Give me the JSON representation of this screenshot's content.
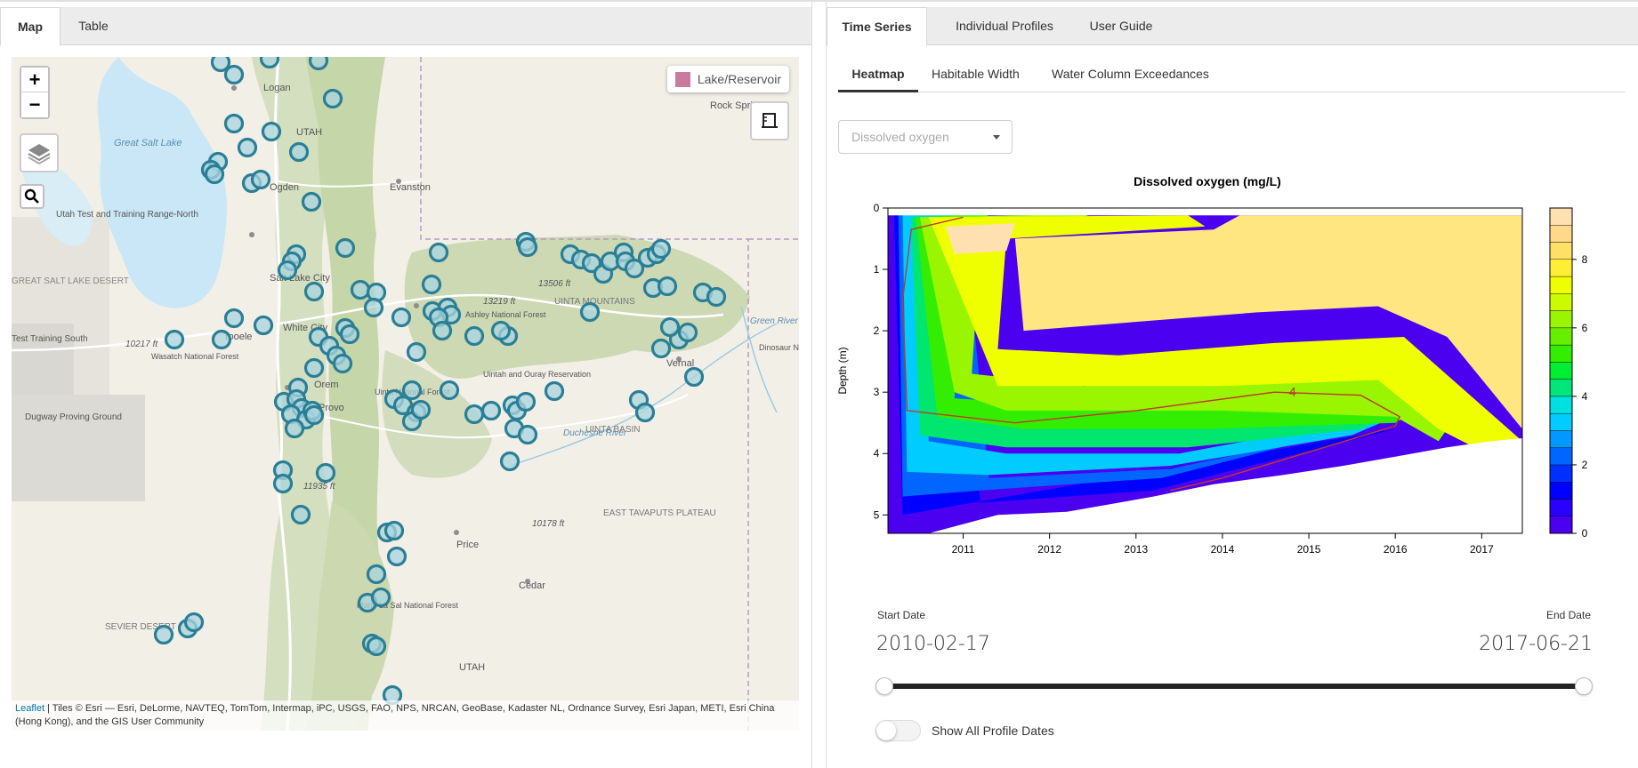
{
  "left_tabs": [
    {
      "label": "Map"
    },
    {
      "label": "Table"
    }
  ],
  "right_tabs": [
    {
      "label": "Time Series"
    },
    {
      "label": "Individual Profiles"
    },
    {
      "label": "User Guide"
    }
  ],
  "sub_tabs": [
    {
      "label": "Heatmap"
    },
    {
      "label": "Habitable Width"
    },
    {
      "label": "Water Column Exceedances"
    }
  ],
  "map": {
    "zoom_in": "+",
    "zoom_out": "−",
    "legend_label": "Lake/Reservoir",
    "legend_color": "#c97b9e",
    "marker_color": "#2a7f96",
    "attribution_link": "Leaflet",
    "attribution_text": " | Tiles © Esri — Esri, DeLorme, NAVTEQ, TomTom, Intermap, iPC, USGS, FAO, NPS, NRCAN, GeoBase, Kadaster NL, Ordnance Survey, Esri Japan, METI, Esri China (Hong Kong), and the GIS User Community",
    "labels": [
      {
        "text": "Logan"
      },
      {
        "text": "UTAH"
      },
      {
        "text": "Great Salt Lake"
      },
      {
        "text": "Ogden"
      },
      {
        "text": "Evanston"
      },
      {
        "text": "Utah Test and Training Range-North"
      },
      {
        "text": "Salt Lake City"
      },
      {
        "text": "GREAT SALT LAKE DESERT"
      },
      {
        "text": "Tooele"
      },
      {
        "text": "White City"
      },
      {
        "text": "10217 ft"
      },
      {
        "text": "Wasatch National Forest"
      },
      {
        "text": "Orem"
      },
      {
        "text": "Provo"
      },
      {
        "text": "Uinta National Forest"
      },
      {
        "text": "Uintah and Ouray Reservation"
      },
      {
        "text": "13506 ft"
      },
      {
        "text": "13219 ft"
      },
      {
        "text": "UINTA MOUNTAINS"
      },
      {
        "text": "Ashley National Forest"
      },
      {
        "text": "Vernal"
      },
      {
        "text": "Dinosaur National Monument"
      },
      {
        "text": "Rock Springs"
      },
      {
        "text": "Duchesne River"
      },
      {
        "text": "UINTA BASIN"
      },
      {
        "text": "Dugway Proving Ground"
      },
      {
        "text": "11935 ft"
      },
      {
        "text": "10178 ft"
      },
      {
        "text": "EAST TAVAPUTS PLATEAU"
      },
      {
        "text": "Price"
      },
      {
        "text": "Cedar"
      },
      {
        "text": "Manti-La Sal National Forest"
      },
      {
        "text": "SEVIER DESERT"
      },
      {
        "text": "UTAH"
      },
      {
        "text": "Green River"
      },
      {
        "text": "Test Training South"
      }
    ],
    "markers_count_note": ""
  },
  "chart": {
    "select_placeholder": "Dissolved oxygen",
    "title": "Dissolved oxygen (mg/L)",
    "ylabel": "Depth (m)",
    "contour_label": "4"
  },
  "chart_data": {
    "type": "heatmap",
    "title": "Dissolved oxygen (mg/L)",
    "xlabel": "",
    "ylabel": "Depth (m)",
    "x_ticks": [
      "2011",
      "2012",
      "2013",
      "2014",
      "2015",
      "2016",
      "2017"
    ],
    "y_ticks": [
      "0",
      "1",
      "2",
      "3",
      "4",
      "5"
    ],
    "xlim": [
      2010.13,
      2017.47
    ],
    "ylim": [
      5.3,
      0
    ],
    "colorbar_ticks": [
      "0",
      "2",
      "4",
      "6",
      "8"
    ],
    "colorbar_range": [
      0,
      9.5
    ],
    "contour_level": 4,
    "contour_line_color": "#c0392b",
    "colorscale": [
      "#4b00f0",
      "#0000ff",
      "#0066ff",
      "#00ccff",
      "#00e66e",
      "#33ee00",
      "#99f500",
      "#f0ff00",
      "#ffe680",
      "#ffe0b0"
    ],
    "grid": false,
    "legend": "colorbar-right"
  },
  "dates": {
    "start_label": "Start Date",
    "end_label": "End Date",
    "start_value": "2010-02-17",
    "end_value": "2017-06-21"
  },
  "toggle": {
    "label": "Show All Profile Dates",
    "on": false
  }
}
